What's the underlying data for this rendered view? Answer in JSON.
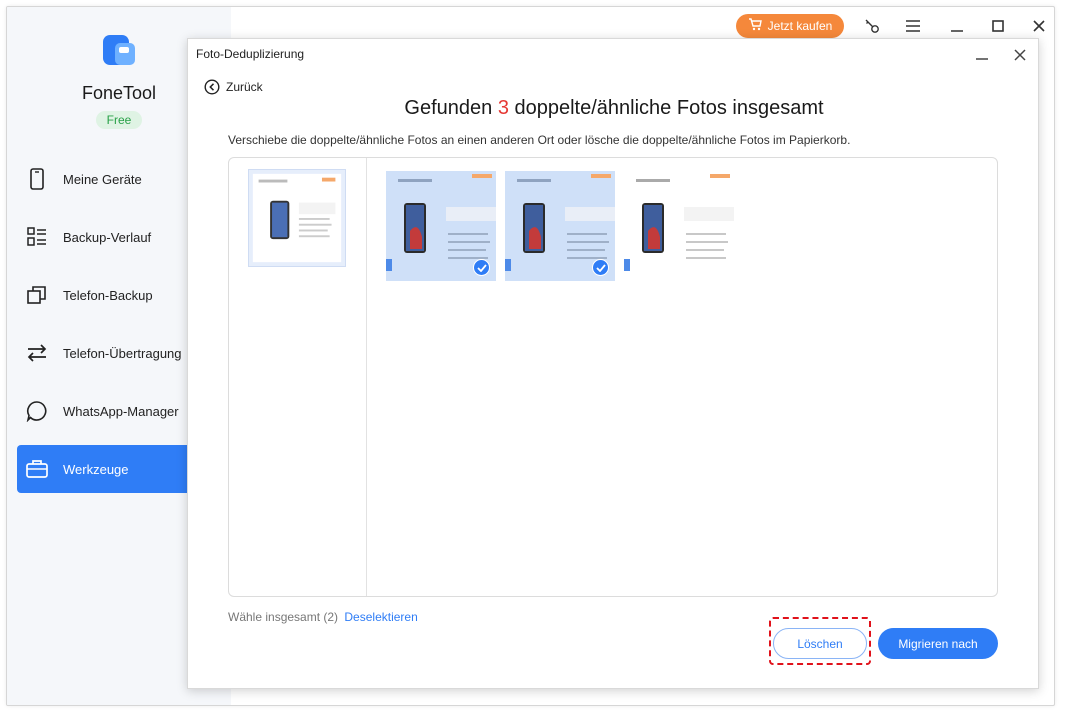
{
  "app": {
    "name": "FoneTool",
    "plan_badge": "Free",
    "accent_color": "#2f7df6",
    "buy_label": "Jetzt kaufen",
    "buy_color": "#f5883b"
  },
  "sidebar": {
    "items": [
      {
        "label": "Meine Geräte",
        "icon": "phone-icon"
      },
      {
        "label": "Backup-Verlauf",
        "icon": "list-icon"
      },
      {
        "label": "Telefon-Backup",
        "icon": "copy-icon"
      },
      {
        "label": "Telefon-Übertragung",
        "icon": "transfer-icon"
      },
      {
        "label": "WhatsApp-Manager",
        "icon": "chat-icon"
      },
      {
        "label": "Werkzeuge",
        "icon": "toolbox-icon",
        "active": true
      }
    ]
  },
  "dialog": {
    "title": "Foto-Deduplizierung",
    "back_label": "Zurück",
    "heading_prefix": "Gefunden",
    "heading_count": "3",
    "heading_suffix": "doppelte/ähnliche Fotos insgesamt",
    "description": "Verschiebe die doppelte/ähnliche Fotos an einen anderen Ort oder lösche die doppelte/ähnliche Fotos im Papierkorb.",
    "photos": [
      {
        "selected": true
      },
      {
        "selected": true
      },
      {
        "selected": false
      }
    ],
    "summary_text": "Wähle insgesamt (2)",
    "deselect_label": "Deselektieren",
    "delete_label": "Löschen",
    "migrate_label": "Migrieren nach"
  }
}
